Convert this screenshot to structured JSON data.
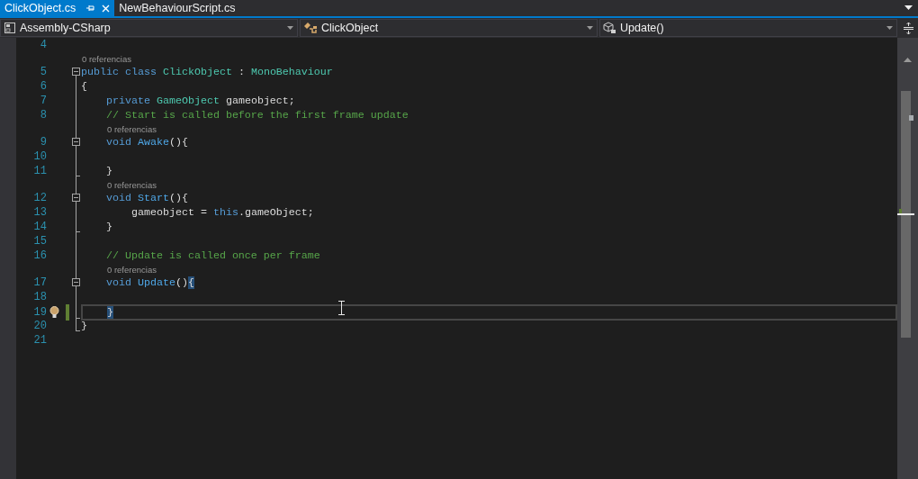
{
  "tabs": [
    {
      "label": "ClickObject.cs",
      "selected": true
    },
    {
      "label": "NewBehaviourScript.cs",
      "selected": false
    }
  ],
  "navigation_bar": [
    {
      "kind": "project",
      "label": "Assembly-CSharp"
    },
    {
      "kind": "class",
      "label": "ClickObject"
    },
    {
      "kind": "method",
      "label": "Update()"
    }
  ],
  "editor": {
    "lines": [
      {
        "number": "4",
        "kind": "outside",
        "current": false,
        "changed": false,
        "lightbulb": false
      },
      {
        "number": "5",
        "lens": "0 referencias",
        "kind": "fold-start",
        "current": false,
        "changed": false,
        "lightbulb": false,
        "tokens": [
          {
            "kind": "keyword",
            "text": "public class "
          },
          {
            "kind": "type",
            "text": "ClickObject"
          },
          {
            "kind": "plain",
            "text": " : "
          },
          {
            "kind": "type",
            "text": "MonoBehaviour"
          }
        ]
      },
      {
        "number": "6",
        "kind": "inside",
        "current": false,
        "changed": false,
        "lightbulb": false,
        "tokens": [
          {
            "kind": "plain",
            "text": "{"
          }
        ]
      },
      {
        "number": "7",
        "kind": "inside",
        "current": false,
        "changed": false,
        "lightbulb": false,
        "tokens": [
          {
            "kind": "keyword",
            "text": "    private "
          },
          {
            "kind": "type",
            "text": "GameObject "
          },
          {
            "kind": "plain",
            "text": "gameobject;"
          }
        ]
      },
      {
        "number": "8",
        "kind": "inside",
        "current": false,
        "changed": false,
        "lightbulb": false,
        "tokens": [
          {
            "kind": "comment",
            "text": "    // Start is called before the first frame update"
          }
        ]
      },
      {
        "number": "9",
        "lens": "0 referencias",
        "kind": "fold-start",
        "current": false,
        "changed": false,
        "lightbulb": false,
        "tokens": [
          {
            "kind": "keyword",
            "text": "    void "
          },
          {
            "kind": "method",
            "text": "Awake"
          },
          {
            "kind": "plain",
            "text": "(){"
          }
        ]
      },
      {
        "number": "10",
        "kind": "inside",
        "current": false,
        "changed": false,
        "lightbulb": false
      },
      {
        "number": "11",
        "kind": "fold-end",
        "current": false,
        "changed": false,
        "lightbulb": false,
        "tokens": [
          {
            "kind": "plain",
            "text": "    }"
          }
        ]
      },
      {
        "number": "12",
        "lens": "0 referencias",
        "kind": "fold-start",
        "current": false,
        "changed": false,
        "lightbulb": false,
        "tokens": [
          {
            "kind": "keyword",
            "text": "    void "
          },
          {
            "kind": "method",
            "text": "Start"
          },
          {
            "kind": "plain",
            "text": "(){"
          }
        ]
      },
      {
        "number": "13",
        "kind": "inside",
        "current": false,
        "changed": false,
        "lightbulb": false,
        "tokens": [
          {
            "kind": "plain",
            "text": "        gameobject = "
          },
          {
            "kind": "keyword",
            "text": "this"
          },
          {
            "kind": "plain",
            "text": ".gameObject;"
          }
        ]
      },
      {
        "number": "14",
        "kind": "fold-end",
        "current": false,
        "changed": false,
        "lightbulb": false,
        "tokens": [
          {
            "kind": "plain",
            "text": "    }"
          }
        ]
      },
      {
        "number": "15",
        "kind": "inside",
        "current": false,
        "changed": false,
        "lightbulb": false
      },
      {
        "number": "16",
        "kind": "inside",
        "current": false,
        "changed": false,
        "lightbulb": false,
        "tokens": [
          {
            "kind": "comment",
            "text": "    // Update is called once per frame"
          }
        ]
      },
      {
        "number": "17",
        "lens": "0 referencias",
        "kind": "fold-start",
        "current": false,
        "changed": false,
        "lightbulb": false,
        "tokens": [
          {
            "kind": "keyword",
            "text": "    void "
          },
          {
            "kind": "method",
            "text": "Update"
          },
          {
            "kind": "plain",
            "text": "()"
          },
          {
            "kind": "matched-brace",
            "text": "{"
          }
        ]
      },
      {
        "number": "18",
        "kind": "inside",
        "current": false,
        "changed": false,
        "lightbulb": false
      },
      {
        "number": "19",
        "kind": "fold-end",
        "current": true,
        "changed": true,
        "lightbulb": true,
        "tokens": [
          {
            "kind": "matched-brace",
            "text": "    }"
          }
        ]
      },
      {
        "number": "20",
        "kind": "fold-end",
        "current": false,
        "changed": false,
        "lightbulb": false,
        "tokens": [
          {
            "kind": "plain",
            "text": "}"
          }
        ]
      },
      {
        "number": "21",
        "kind": "outside",
        "current": false,
        "changed": false,
        "lightbulb": false
      }
    ]
  }
}
